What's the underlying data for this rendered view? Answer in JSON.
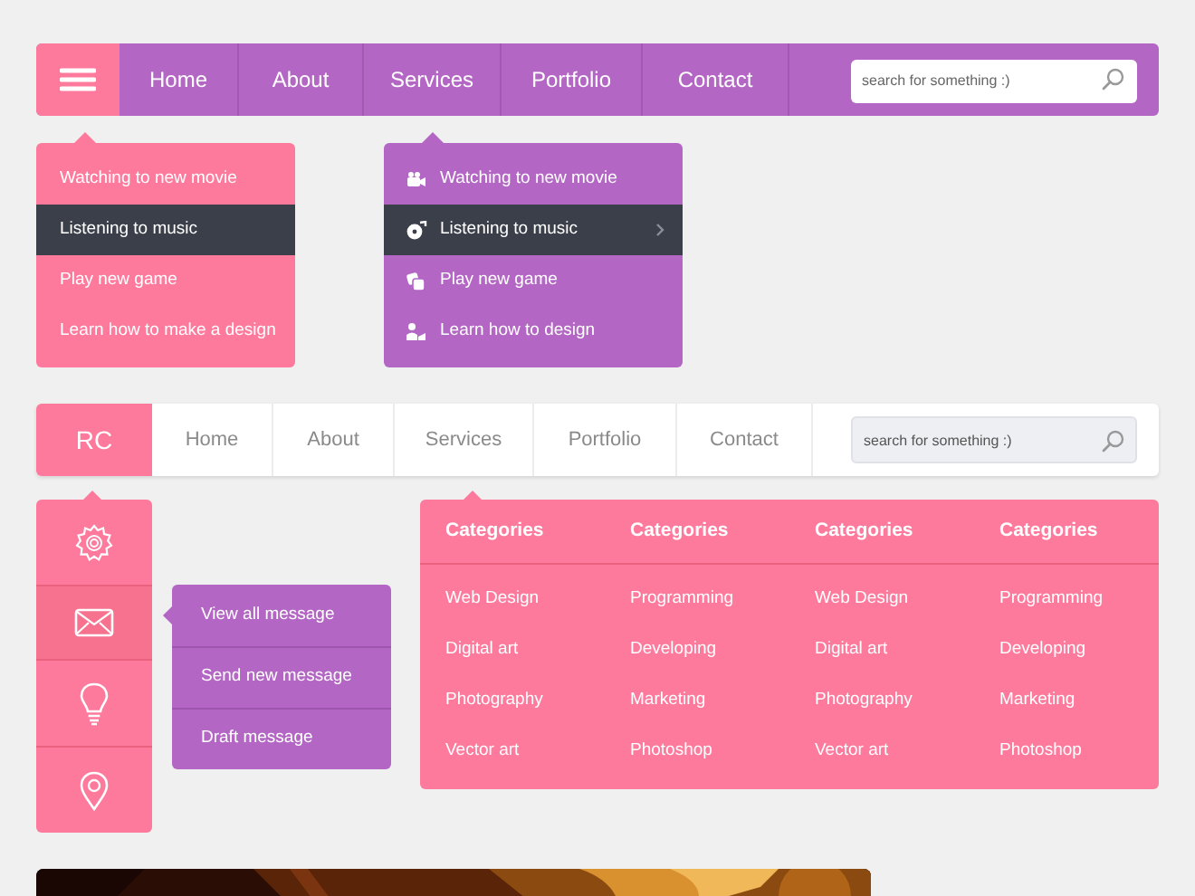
{
  "top_nav": {
    "items": [
      {
        "label": "Home"
      },
      {
        "label": "About"
      },
      {
        "label": "Services"
      },
      {
        "label": "Portfolio"
      },
      {
        "label": "Contact"
      }
    ],
    "search": {
      "placeholder": "search for something :)"
    }
  },
  "dropdowns": [
    {
      "items": [
        {
          "label": "Watching to new movie",
          "selected": false
        },
        {
          "label": "Listening to music",
          "selected": true
        },
        {
          "label": "Play new game",
          "selected": false
        },
        {
          "label": "Learn how to make a design",
          "selected": false
        }
      ]
    },
    {
      "items": [
        {
          "label": "Watching to new movie",
          "selected": false,
          "has_arrow": false
        },
        {
          "label": "Listening to music",
          "selected": true,
          "has_arrow": true
        },
        {
          "label": "Play new game",
          "selected": false,
          "has_arrow": false
        },
        {
          "label": "Learn how to design",
          "selected": false,
          "has_arrow": false
        }
      ]
    }
  ],
  "second_nav": {
    "logo": "RC",
    "items": [
      {
        "label": "Home"
      },
      {
        "label": "About"
      },
      {
        "label": "Services"
      },
      {
        "label": "Portfolio"
      },
      {
        "label": "Contact"
      }
    ],
    "search": {
      "placeholder": "search for something :)"
    }
  },
  "sidebar": {
    "items": [
      {
        "expanded": false
      },
      {
        "expanded": true
      },
      {
        "expanded": false
      },
      {
        "expanded": false
      }
    ],
    "submenu": [
      "View all message",
      "Send new message",
      "Draft message"
    ]
  },
  "mega_menu": {
    "columns": [
      {
        "heading": "Categories",
        "links": [
          "Web Design",
          "Digital art",
          "Photography",
          "Vector art"
        ]
      },
      {
        "heading": "Categories",
        "links": [
          "Programming",
          "Developing",
          "Marketing",
          "Photoshop"
        ]
      },
      {
        "heading": "Categories",
        "links": [
          "Web Design",
          "Digital art",
          "Photography",
          "Vector art"
        ]
      },
      {
        "heading": "Categories",
        "links": [
          "Programming",
          "Developing",
          "Marketing",
          "Photoshop"
        ]
      }
    ]
  }
}
